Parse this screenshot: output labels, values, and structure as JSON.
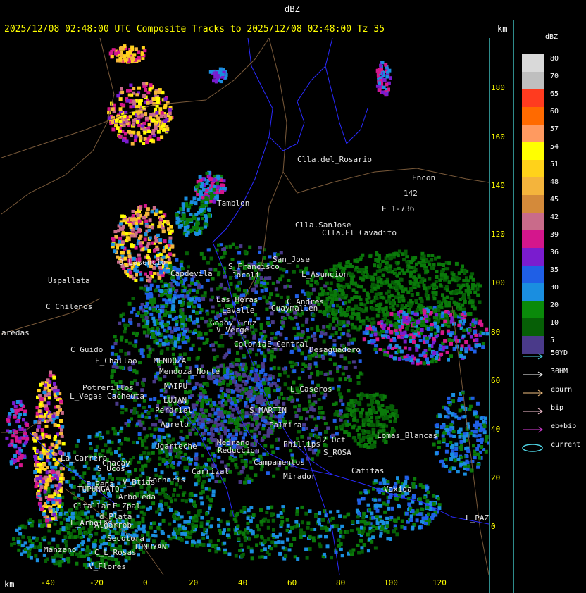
{
  "header": {
    "unit_title": "dBZ"
  },
  "title": {
    "text": "2025/12/08 02:48:00 UTC Composite Tracks to 2025/12/08 02:48:00 Tz 35",
    "km_label": "km"
  },
  "axis": {
    "y_ticks": [
      "180",
      "160",
      "140",
      "120",
      "100",
      "80",
      "60",
      "40",
      "20",
      "0"
    ],
    "x_ticks": [
      "-40",
      "-20",
      "0",
      "20",
      "40",
      "60",
      "80",
      "100",
      "120"
    ],
    "km_label": "km"
  },
  "legend": {
    "title": "dBZ",
    "scale": [
      {
        "value": "80",
        "color": "#d9d9d9"
      },
      {
        "value": "70",
        "color": "#bfbfbf"
      },
      {
        "value": "65",
        "color": "#ff3b1f"
      },
      {
        "value": "60",
        "color": "#ff6a00"
      },
      {
        "value": "57",
        "color": "#ff9a60"
      },
      {
        "value": "54",
        "color": "#ffff00"
      },
      {
        "value": "51",
        "color": "#ffd21a"
      },
      {
        "value": "48",
        "color": "#f4b43c"
      },
      {
        "value": "45",
        "color": "#d48a3a"
      },
      {
        "value": "42",
        "color": "#c96b8a"
      },
      {
        "value": "39",
        "color": "#d4168c"
      },
      {
        "value": "36",
        "color": "#7a1ccf"
      },
      {
        "value": "35",
        "color": "#1f5fe6"
      },
      {
        "value": "30",
        "color": "#1a8ee0"
      },
      {
        "value": "20",
        "color": "#0a8a0a"
      },
      {
        "value": "10",
        "color": "#065f06"
      },
      {
        "value": "5",
        "color": "#4a3a8a"
      }
    ],
    "tracks": [
      {
        "label": "50YD",
        "color": "#4fd6e6"
      },
      {
        "label": "30HM",
        "color": "#ffffff"
      },
      {
        "label": "eburn",
        "color": "#f2c080"
      },
      {
        "label": "bip",
        "color": "#ffc8d8"
      },
      {
        "label": "eb+bip",
        "color": "#e040e0"
      },
      {
        "label": "current",
        "color": "#4fd6e6"
      }
    ]
  },
  "places": [
    {
      "name": "Clla.del_Rosario"
    },
    {
      "name": "Encon"
    },
    {
      "name": "142"
    },
    {
      "name": "E_1-736"
    },
    {
      "name": "Tamblon"
    },
    {
      "name": "Clla.SanJose"
    },
    {
      "name": "Clla.El_Cavadito"
    },
    {
      "name": "San_Jose"
    },
    {
      "name": "L_Asuncion"
    },
    {
      "name": "D_Lasencio"
    },
    {
      "name": "Uspallata"
    },
    {
      "name": "Capdevila"
    },
    {
      "name": "S_Francisco"
    },
    {
      "name": "Jocoli"
    },
    {
      "name": "C_Chilenos"
    },
    {
      "name": "Las_Heras"
    },
    {
      "name": "Lavalle"
    },
    {
      "name": "C_Andres"
    },
    {
      "name": "Guaymallen"
    },
    {
      "name": "aredas"
    },
    {
      "name": "V_Vergel"
    },
    {
      "name": "Godoy_Cruz"
    },
    {
      "name": "Colonia"
    },
    {
      "name": "E_Central"
    },
    {
      "name": "Desaguadero"
    },
    {
      "name": "C_Guido"
    },
    {
      "name": "E_Challao"
    },
    {
      "name": "MENDOZA"
    },
    {
      "name": "Mendoza_Norte"
    },
    {
      "name": "Potrerillos"
    },
    {
      "name": "Cacheuta"
    },
    {
      "name": "L_Vegas"
    },
    {
      "name": "MAIPU"
    },
    {
      "name": "LUJAN"
    },
    {
      "name": "Perdriel"
    },
    {
      "name": "S_MARTIN"
    },
    {
      "name": "L_Caseros"
    },
    {
      "name": "Agrelo"
    },
    {
      "name": "Palmira"
    },
    {
      "name": "Ugarteche"
    },
    {
      "name": "12_Oct"
    },
    {
      "name": "Lomas_Blancas"
    },
    {
      "name": "Medrano"
    },
    {
      "name": "Reduccion"
    },
    {
      "name": "Phillips"
    },
    {
      "name": "S_ROSA"
    },
    {
      "name": "La_Carrera"
    },
    {
      "name": "Chacay"
    },
    {
      "name": "S_Ucos"
    },
    {
      "name": "Carrizal"
    },
    {
      "name": "Anchoris"
    },
    {
      "name": "Campamentos"
    },
    {
      "name": "Catitas"
    },
    {
      "name": "Mirador"
    },
    {
      "name": "E_Pena"
    },
    {
      "name": "V_Btias"
    },
    {
      "name": "TUPUNGATO"
    },
    {
      "name": "Arboleda"
    },
    {
      "name": "Vaxida"
    },
    {
      "name": "Gltallar"
    },
    {
      "name": "E_Zpal"
    },
    {
      "name": "L_Arboles"
    },
    {
      "name": "d_Plata"
    },
    {
      "name": "L_PAZ"
    },
    {
      "name": "Algarrob"
    },
    {
      "name": "Secotora"
    },
    {
      "name": "TUNUYAN"
    },
    {
      "name": "Manzano"
    },
    {
      "name": "C_L_Rosas"
    },
    {
      "name": "V_Flores"
    }
  ]
}
